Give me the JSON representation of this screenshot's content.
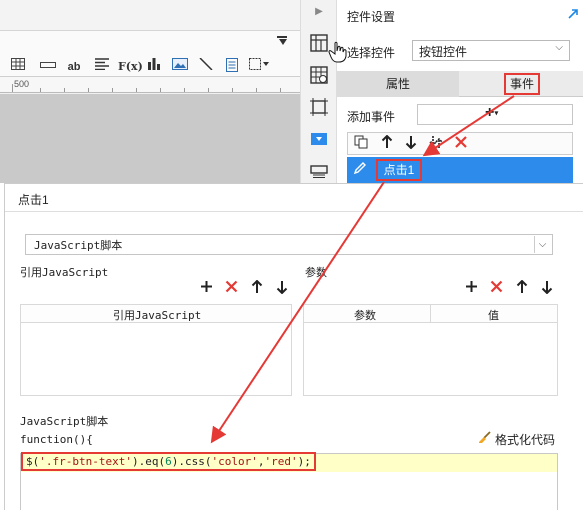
{
  "ruler": {
    "label": "500"
  },
  "panel": {
    "title": "控件设置",
    "select_label": "选择控件",
    "select_value": "按钮控件",
    "tabs": [
      {
        "label": "属性"
      },
      {
        "label": "事件"
      }
    ],
    "add_event_label": "添加事件",
    "event_item": "点击1"
  },
  "dialog": {
    "title": "点击1",
    "type_select": "JavaScript脚本",
    "ref_js_label": "引用JavaScript",
    "params_label": "参数",
    "ref_table_header": "引用JavaScript",
    "param_table_headers": [
      "参数",
      "值"
    ],
    "script_label": "JavaScript脚本",
    "function_line": "function(){",
    "format_button": "格式化代码",
    "code": {
      "p1": "$(",
      "s1": "'.fr-btn-text'",
      "p2": ").eq(",
      "n1": "6",
      "p3": ").css(",
      "s2": "'color'",
      "p4": ",",
      "s3": "'red'",
      "p5": ");"
    }
  },
  "colors": {
    "accent_blue": "#2d8ceb",
    "highlight_red": "#e53935",
    "code_highlight": "#ffffc8"
  },
  "icons": [
    "table-icon",
    "divider-icon",
    "text-format-icon",
    "align-icon",
    "formula-icon",
    "bar-chart-icon",
    "image-icon",
    "line-icon",
    "page-icon",
    "border-icon",
    "collapse-arrow-icon",
    "pin-icon",
    "hand-cursor-icon",
    "copy-icon",
    "arrow-up-icon",
    "arrow-down-icon",
    "move-icon",
    "delete-icon",
    "plus-icon",
    "pencil-icon",
    "brush-icon"
  ]
}
